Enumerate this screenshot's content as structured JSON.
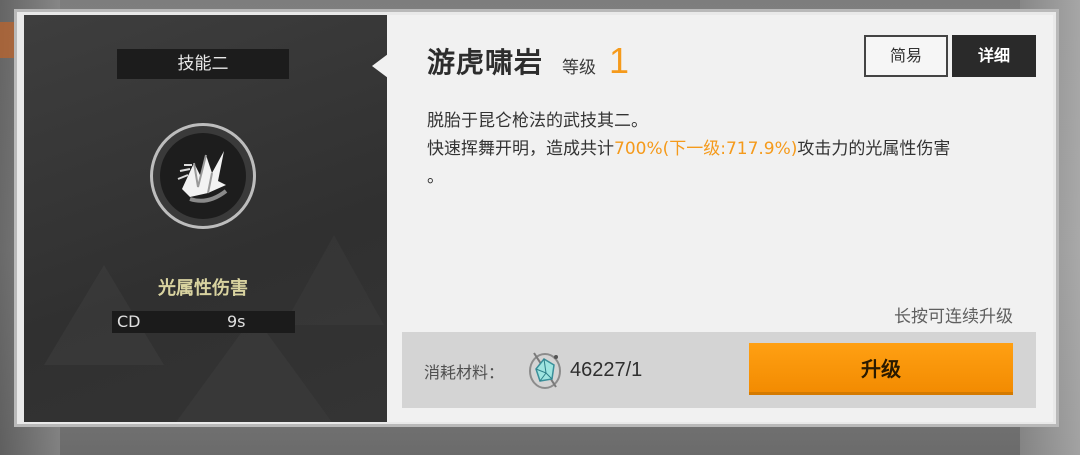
{
  "skill_panel": {
    "slot_label": "技能二",
    "icon": "crystal-burst-icon",
    "damage_type": "光属性伤害",
    "cd": {
      "label": "CD",
      "value": "9s"
    }
  },
  "detail": {
    "name": "游虎啸岩",
    "level_label": "等级",
    "level_value": "1",
    "tabs": {
      "simple": "简易",
      "detail": "详细",
      "active": "detail"
    },
    "description": {
      "line1": "脱胎于昆仑枪法的武技其二。",
      "line2_before": "快速挥舞开明，造成共计",
      "line2_highlight": "700%(下一级:717.9%)",
      "line2_after": "攻击力的光属性伤害",
      "line3": "。"
    },
    "hint": "长按可连续升级"
  },
  "cost": {
    "label": "消耗材料：",
    "material_icon": "crystal-material-icon",
    "value": "46227/1",
    "upgrade_label": "升级"
  },
  "colors": {
    "accent": "#f59a1b",
    "button": "#f59a1b",
    "damage_type": "#d9d3a0",
    "panel_dark": "#333333",
    "panel_light": "#f1f1f1"
  }
}
